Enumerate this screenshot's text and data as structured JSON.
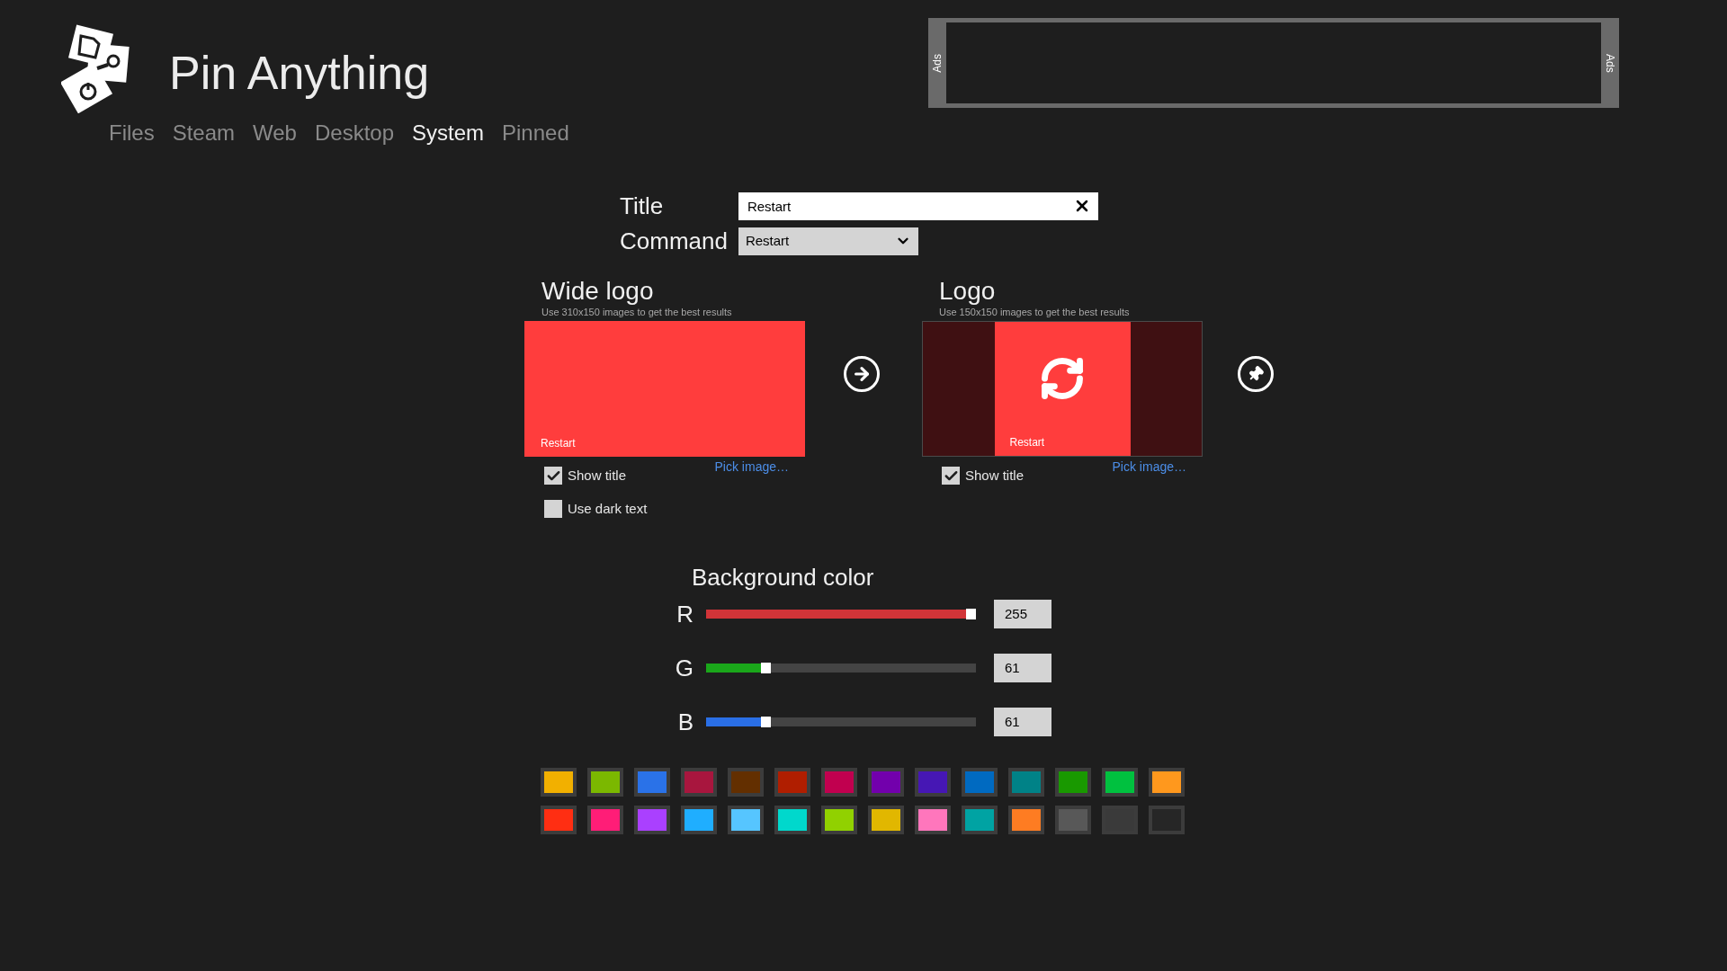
{
  "app": {
    "title": "Pin Anything"
  },
  "tabs": [
    {
      "label": "Files",
      "selected": false
    },
    {
      "label": "Steam",
      "selected": false
    },
    {
      "label": "Web",
      "selected": false
    },
    {
      "label": "Desktop",
      "selected": false
    },
    {
      "label": "System",
      "selected": true
    },
    {
      "label": "Pinned",
      "selected": false
    }
  ],
  "ads": {
    "left_label": "Ads",
    "right_label": "Ads"
  },
  "form": {
    "title": {
      "label": "Title",
      "value": "Restart"
    },
    "command": {
      "label": "Command",
      "value": "Restart"
    }
  },
  "wide_logo": {
    "heading": "Wide logo",
    "hint": "Use 310x150 images to get the best results",
    "tile_title": "Restart",
    "pick_link": "Pick image…",
    "options": [
      {
        "label": "Show title",
        "checked": true
      },
      {
        "label": "Use dark text",
        "checked": false
      }
    ]
  },
  "logo": {
    "heading": "Logo",
    "hint": "Use 150x150 images to get the best results",
    "tile_title": "Restart",
    "pick_link": "Pick image…",
    "options": [
      {
        "label": "Show title",
        "checked": true
      }
    ]
  },
  "background_color": {
    "heading": "Background color",
    "channels": [
      {
        "name": "R",
        "level": 1,
        "value": "255",
        "color": "#d13438"
      },
      {
        "name": "G",
        "level": 0.24,
        "value": "61",
        "color": "#1aa71a"
      },
      {
        "name": "B",
        "level": 0.24,
        "value": "61",
        "color": "#2a6fe6"
      }
    ]
  },
  "swatches": [
    {
      "color": "#f2b000"
    },
    {
      "color": "#7bb800"
    },
    {
      "color": "#2a72e8"
    },
    {
      "color": "#a8163e"
    },
    {
      "color": "#632f00"
    },
    {
      "color": "#b01e00"
    },
    {
      "color": "#c1004f"
    },
    {
      "color": "#7200ac"
    },
    {
      "color": "#4617b4"
    },
    {
      "color": "#006ac1"
    },
    {
      "color": "#008287"
    },
    {
      "color": "#199900"
    },
    {
      "color": "#00c13f"
    },
    {
      "color": "#ff981d"
    },
    {
      "color": "#ff2e12"
    },
    {
      "color": "#ff1d77"
    },
    {
      "color": "#aa40ff"
    },
    {
      "color": "#1faeff"
    },
    {
      "color": "#56c5ff"
    },
    {
      "color": "#00d8cc"
    },
    {
      "color": "#91d100"
    },
    {
      "color": "#e1b700"
    },
    {
      "color": "#ff76bc"
    },
    {
      "color": "#00a3a3"
    },
    {
      "color": "#fe7c22"
    },
    {
      "color": "#585858"
    },
    {
      "color": "#3a3a3a"
    },
    {
      "color": "#262626"
    }
  ]
}
